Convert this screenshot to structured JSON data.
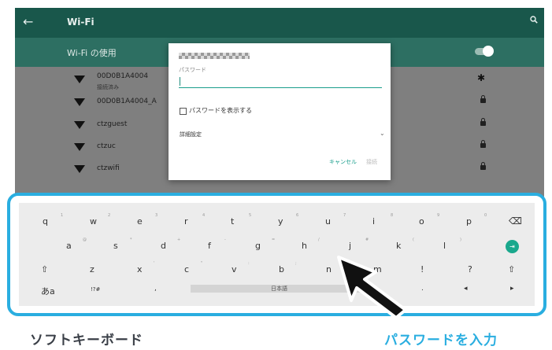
{
  "appbar": {
    "back_icon": "←",
    "title": "Wi-Fi",
    "search_icon": "🔍"
  },
  "wifi_toggle_label": "Wi-Fi の使用",
  "networks": [
    {
      "name": "00D0B1A4004",
      "status": "接続済み"
    },
    {
      "name": "00D0B1A4004_A"
    },
    {
      "name": "ctzguest"
    },
    {
      "name": "ctzuc"
    },
    {
      "name": "ctzwifi"
    }
  ],
  "dialog": {
    "password_label": "パスワード",
    "password_value": "",
    "show_password_label": "パスワードを表示する",
    "advanced_label": "詳細設定",
    "cancel_label": "キャンセル",
    "connect_label": "接続"
  },
  "keyboard": {
    "row1": [
      "q",
      "w",
      "e",
      "r",
      "t",
      "y",
      "u",
      "i",
      "o",
      "p"
    ],
    "row1_hints": [
      "1",
      "2",
      "3",
      "4",
      "5",
      "6",
      "7",
      "8",
      "9",
      "0"
    ],
    "row2": [
      "a",
      "s",
      "d",
      "f",
      "g",
      "h",
      "j",
      "k",
      "l"
    ],
    "row2_hints": [
      "@",
      "*",
      "+",
      "-",
      "=",
      "/",
      "#",
      "(",
      ")"
    ],
    "row3": [
      "z",
      "x",
      "c",
      "v",
      "b",
      "n",
      "m",
      "!",
      "?"
    ],
    "row3_hints": [
      "",
      "'",
      "\"",
      ":",
      ";",
      "",
      "",
      "",
      ""
    ],
    "backspace": "⌫",
    "enter": "⇥",
    "shift": "⇧",
    "lang_key": "あa",
    "symbols_key": "!?#",
    "comma": ",",
    "space_label": "日本語",
    "period": ".",
    "left_arrow": "◂",
    "right_arrow": "▸"
  },
  "captions": {
    "left": "ソフトキーボード",
    "right": "パスワードを入力"
  },
  "colors": {
    "appbar": "#19574b",
    "accent": "#1a9e8c",
    "frame": "#2aaee0",
    "caption": "#3a3f47"
  }
}
